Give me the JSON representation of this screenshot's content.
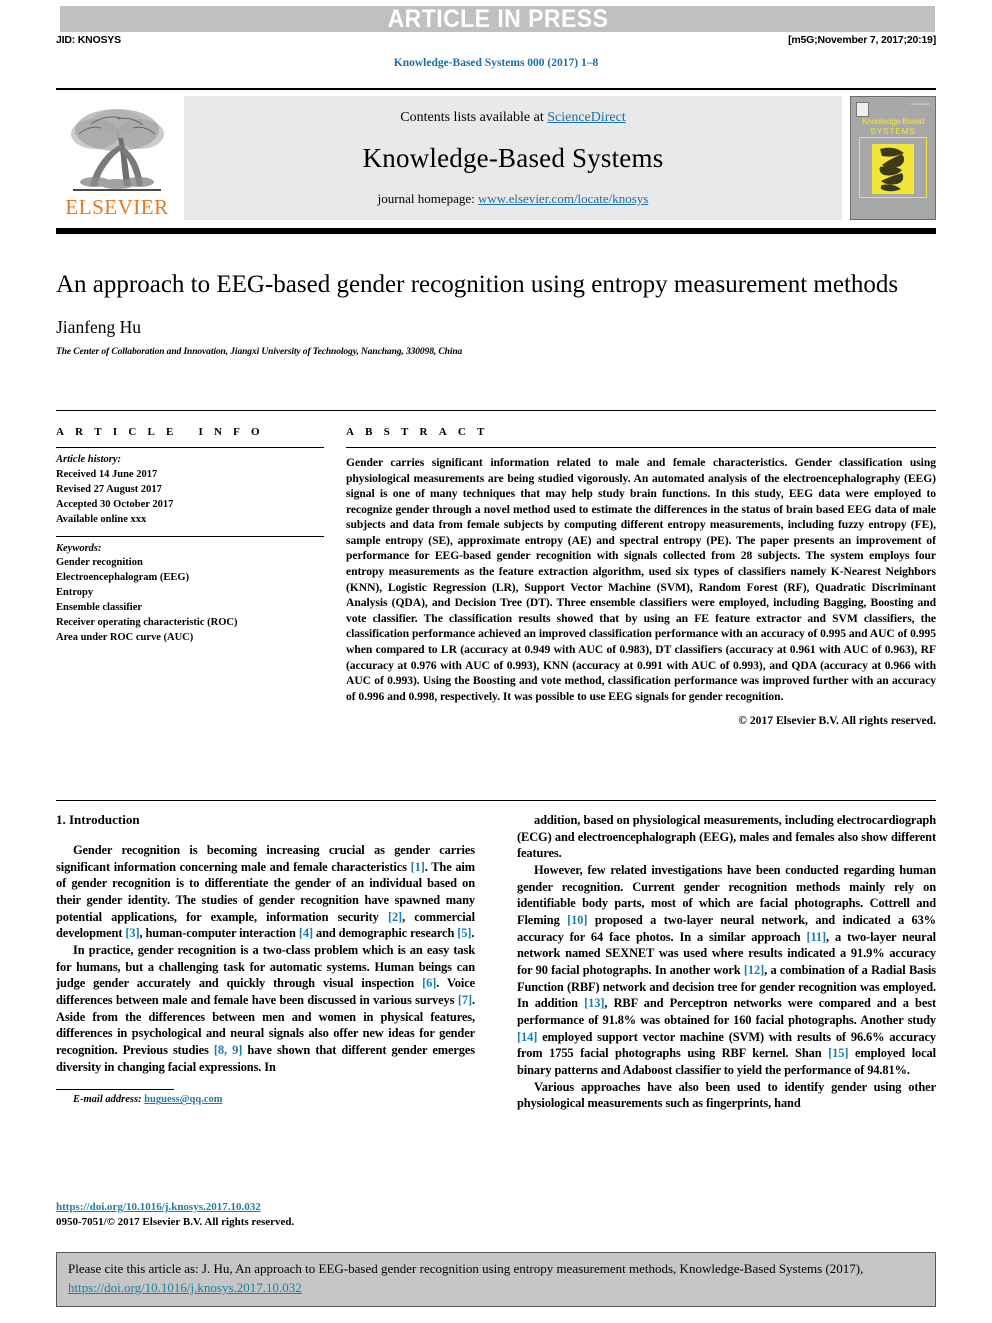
{
  "banner": {
    "text": "ARTICLE IN PRESS"
  },
  "header": {
    "jid": "JID: KNOSYS",
    "build_stamp": "[m5G;November 7, 2017;20:19]",
    "running_head": "Knowledge-Based Systems 000 (2017) 1–8"
  },
  "masthead": {
    "publisher": "ELSEVIER",
    "contents_prefix": "Contents lists available at ",
    "contents_link": "ScienceDirect",
    "journal_title": "Knowledge-Based Systems",
    "homepage_prefix": "journal homepage: ",
    "homepage_link": "www.elsevier.com/locate/knosys",
    "cover": {
      "line1": "Knowledge-Based",
      "line2": "SYSTEMS",
      "accent_color": "#f3e63a",
      "background_color": "#a8a8a8"
    },
    "elsevier_color": "#E87722"
  },
  "article": {
    "title": "An approach to EEG-based gender recognition using entropy measurement methods",
    "author": "Jianfeng Hu",
    "affiliation": "The Center of Collaboration and Innovation, Jiangxi University of Technology, Nanchang, 330098, China"
  },
  "article_info": {
    "heading": "ARTICLE INFO",
    "history_label": "Article history:",
    "history": [
      "Received 14 June 2017",
      "Revised 27 August 2017",
      "Accepted 30 October 2017",
      "Available online xxx"
    ],
    "keywords_label": "Keywords:",
    "keywords": [
      "Gender recognition",
      "Electroencephalogram (EEG)",
      "Entropy",
      "Ensemble classifier",
      "Receiver operating characteristic (ROC)",
      "Area under ROC curve (AUC)"
    ]
  },
  "abstract": {
    "heading": "ABSTRACT",
    "text": "Gender carries significant information related to male and female characteristics. Gender classification using physiological measurements are being studied vigorously. An automated analysis of the electroencephalography (EEG) signal is one of many techniques that may help study brain functions. In this study, EEG data were employed to recognize gender through a novel method used to estimate the differences in the status of brain based EEG data of male subjects and data from female subjects by computing different entropy measurements, including fuzzy entropy (FE), sample entropy (SE), approximate entropy (AE) and spectral entropy (PE). The paper presents an improvement of performance for EEG-based gender recognition with signals collected from 28 subjects. The system employs four entropy measurements as the feature extraction algorithm, used six types of classifiers namely K-Nearest Neighbors (KNN), Logistic Regression (LR), Support Vector Machine (SVM), Random Forest (RF), Quadratic Discriminant Analysis (QDA), and Decision Tree (DT). Three ensemble classifiers were employed, including Bagging, Boosting and vote classifier. The classification results showed that by using an FE feature extractor and SVM classifiers, the classification performance achieved an improved classification performance with an accuracy of 0.995 and AUC of 0.995 when compared to LR (accuracy at 0.949 with AUC of 0.983), DT classifiers (accuracy at 0.961 with AUC of 0.963), RF (accuracy at 0.976 with AUC of 0.993), KNN (accuracy at 0.991 with AUC of 0.993), and QDA (accuracy at 0.966 with AUC of 0.993). Using the Boosting and vote method, classification performance was improved further with an accuracy of 0.996 and 0.998, respectively. It was possible to use EEG signals for gender recognition.",
    "copyright": "© 2017 Elsevier B.V. All rights reserved."
  },
  "introduction": {
    "heading": "1. Introduction",
    "left_paragraphs": [
      "Gender recognition is becoming increasing crucial as gender carries significant information concerning male and female characteristics [1]. The aim of gender recognition is to differentiate the gender of an individual based on their gender identity. The studies of gender recognition have spawned many potential applications, for example, information security [2], commercial development [3], human-computer interaction [4] and demographic research [5].",
      "In practice, gender recognition is a two-class problem which is an easy task for humans, but a challenging task for automatic systems. Human beings can judge gender accurately and quickly through visual inspection [6]. Voice differences between male and female have been discussed in various surveys [7]. Aside from the differences between men and women in physical features, differences in psychological and neural signals also offer new ideas for gender recognition. Previous studies [8, 9] have shown that different gender emerges diversity in changing facial expressions. In"
    ],
    "right_paragraphs": [
      "addition, based on physiological measurements, including electrocardiograph (ECG) and electroencephalograph (EEG), males and females also show different features.",
      "However, few related investigations have been conducted regarding human gender recognition. Current gender recognition methods mainly rely on identifiable body parts, most of which are facial photographs. Cottrell and Fleming [10] proposed a two-layer neural network, and indicated a 63% accuracy for 64 face photos. In a similar approach [11], a two-layer neural network named SEXNET was used where results indicated a 91.9% accuracy for 90 facial photographs. In another work [12], a combination of a Radial Basis Function (RBF) network and decision tree for gender recognition was employed. In addition [13], RBF and Perceptron networks were compared and a best performance of 91.8% was obtained for 160 facial photographs. Another study [14] employed support vector machine (SVM) with results of 96.6% accuracy from 1755 facial photographs using RBF kernel. Shan [15] employed local binary patterns and Adaboost classifier to yield the performance of 94.81%.",
      "Various approaches have also been used to identify gender using other physiological measurements such as fingerprints, hand"
    ]
  },
  "footnote": {
    "email_label": "E-mail address:",
    "email": "huguess@qq.com"
  },
  "doi_block": {
    "doi_link": "https://doi.org/10.1016/j.knosys.2017.10.032",
    "issn_line": "0950-7051/© 2017 Elsevier B.V. All rights reserved."
  },
  "cite_box": {
    "text": "Please cite this article as: J. Hu, An approach to EEG-based gender recognition using entropy measurement methods, Knowledge-Based Systems (2017), ",
    "link": "https://doi.org/10.1016/j.knosys.2017.10.032"
  },
  "colors": {
    "link": "#1a7fa8",
    "banner_bg": "#c0c0c0",
    "panel_bg": "#e9e9e9",
    "cite_bg": "#c6c6c6"
  }
}
